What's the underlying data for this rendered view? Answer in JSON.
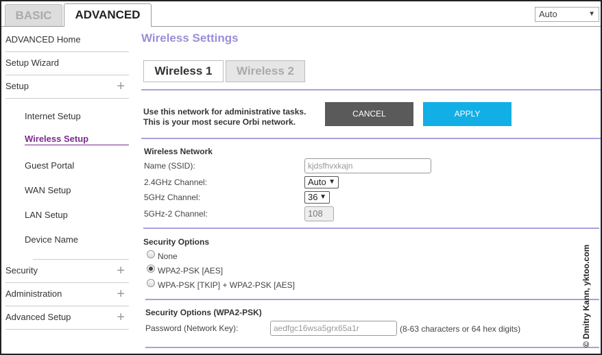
{
  "top_tabs": {
    "basic": "BASIC",
    "advanced": "ADVANCED"
  },
  "language_select": {
    "value": "Auto"
  },
  "sidebar": {
    "items": [
      {
        "label": "ADVANCED Home"
      },
      {
        "label": "Setup Wizard"
      },
      {
        "label": "Setup",
        "expandable": true
      },
      {
        "label": "Security",
        "expandable": true
      },
      {
        "label": "Administration",
        "expandable": true
      },
      {
        "label": "Advanced Setup",
        "expandable": true
      }
    ],
    "setup_sub": [
      {
        "label": "Internet Setup"
      },
      {
        "label": "Wireless Setup",
        "active": true
      },
      {
        "label": "Guest Portal"
      },
      {
        "label": "WAN Setup"
      },
      {
        "label": "LAN Setup"
      },
      {
        "label": "Device Name"
      }
    ]
  },
  "main": {
    "title": "Wireless Settings",
    "tabs": [
      {
        "label": "Wireless 1",
        "active": true
      },
      {
        "label": "Wireless 2"
      }
    ],
    "admin_note_line1": "Use this network for administrative tasks.",
    "admin_note_line2": "This is your most secure Orbi network.",
    "cancel_label": "CANCEL",
    "apply_label": "APPLY",
    "wireless_network": {
      "heading": "Wireless Network",
      "ssid_label": "Name (SSID):",
      "ssid_value": "kjdsfhvxkajn",
      "ch24_label": "2.4GHz Channel:",
      "ch24_value": "Auto",
      "ch5_label": "5GHz Channel:",
      "ch5_value": "36",
      "ch52_label": "5GHz-2 Channel:",
      "ch52_value": "108"
    },
    "security_options": {
      "heading": "Security Options",
      "options": [
        {
          "label": "None",
          "selected": false
        },
        {
          "label": "WPA2-PSK [AES]",
          "selected": true
        },
        {
          "label": "WPA-PSK [TKIP] + WPA2-PSK [AES]",
          "selected": false
        }
      ]
    },
    "wpa2": {
      "heading": "Security Options (WPA2-PSK)",
      "password_label": "Password (Network Key):",
      "password_value": "aedfgc16wsa5grx65a1r",
      "password_hint": "(8-63 characters or 64 hex digits)"
    }
  },
  "watermark": "© Dmitry Kann, yktoo.com",
  "colors": {
    "accent_purple": "#9a8fd8",
    "active_nav": "#7a2a8f",
    "apply_blue": "#12aee6",
    "cancel_gray": "#5a5a5a"
  },
  "icons": {
    "expand": "plus-icon",
    "dropdown": "caret-down-icon"
  }
}
